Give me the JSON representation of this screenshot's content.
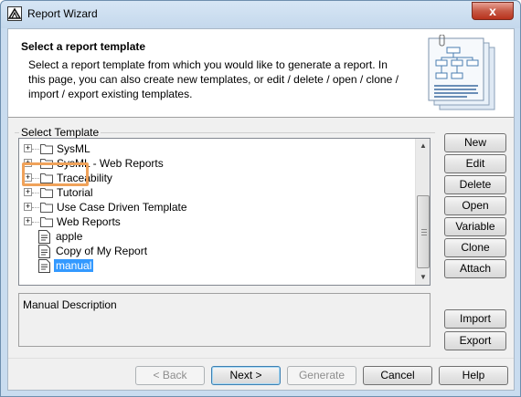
{
  "window": {
    "title": "Report Wizard",
    "close_glyph": "x"
  },
  "header": {
    "title": "Select a report template",
    "description": "Select a report template from which you would like to generate a report. In this page, you can also create new templates, or edit / delete / open / clone / import / export existing templates."
  },
  "template_group": {
    "label": "Select Template"
  },
  "tree": {
    "folders": [
      {
        "label": "SysML",
        "expander": "+"
      },
      {
        "label": "SysML - Web Reports",
        "expander": "+"
      },
      {
        "label": "Traceability",
        "expander": "+"
      },
      {
        "label": "Tutorial",
        "expander": "+"
      },
      {
        "label": "Use Case Driven Template",
        "expander": "+"
      },
      {
        "label": "Web Reports",
        "expander": "+"
      }
    ],
    "documents": [
      {
        "label": "apple"
      },
      {
        "label": "Copy of My Report"
      },
      {
        "label": "manual",
        "selected": true
      }
    ]
  },
  "description": {
    "text": "Manual Description"
  },
  "side_buttons": {
    "new": "New",
    "edit": "Edit",
    "delete": "Delete",
    "open": "Open",
    "variable": "Variable",
    "clone": "Clone",
    "attach": "Attach",
    "import": "Import",
    "export": "Export"
  },
  "bottom_buttons": {
    "back": "< Back",
    "next": "Next >",
    "generate": "Generate",
    "cancel": "Cancel",
    "help": "Help"
  },
  "colors": {
    "selection": "#3399ff",
    "highlight_box": "#f0a25a",
    "close_button": "#c75a46"
  },
  "icons": {
    "app": "magicdraw-icon",
    "folder": "folder-icon",
    "document": "template-document-icon",
    "header_art": "report-template-illustration"
  }
}
